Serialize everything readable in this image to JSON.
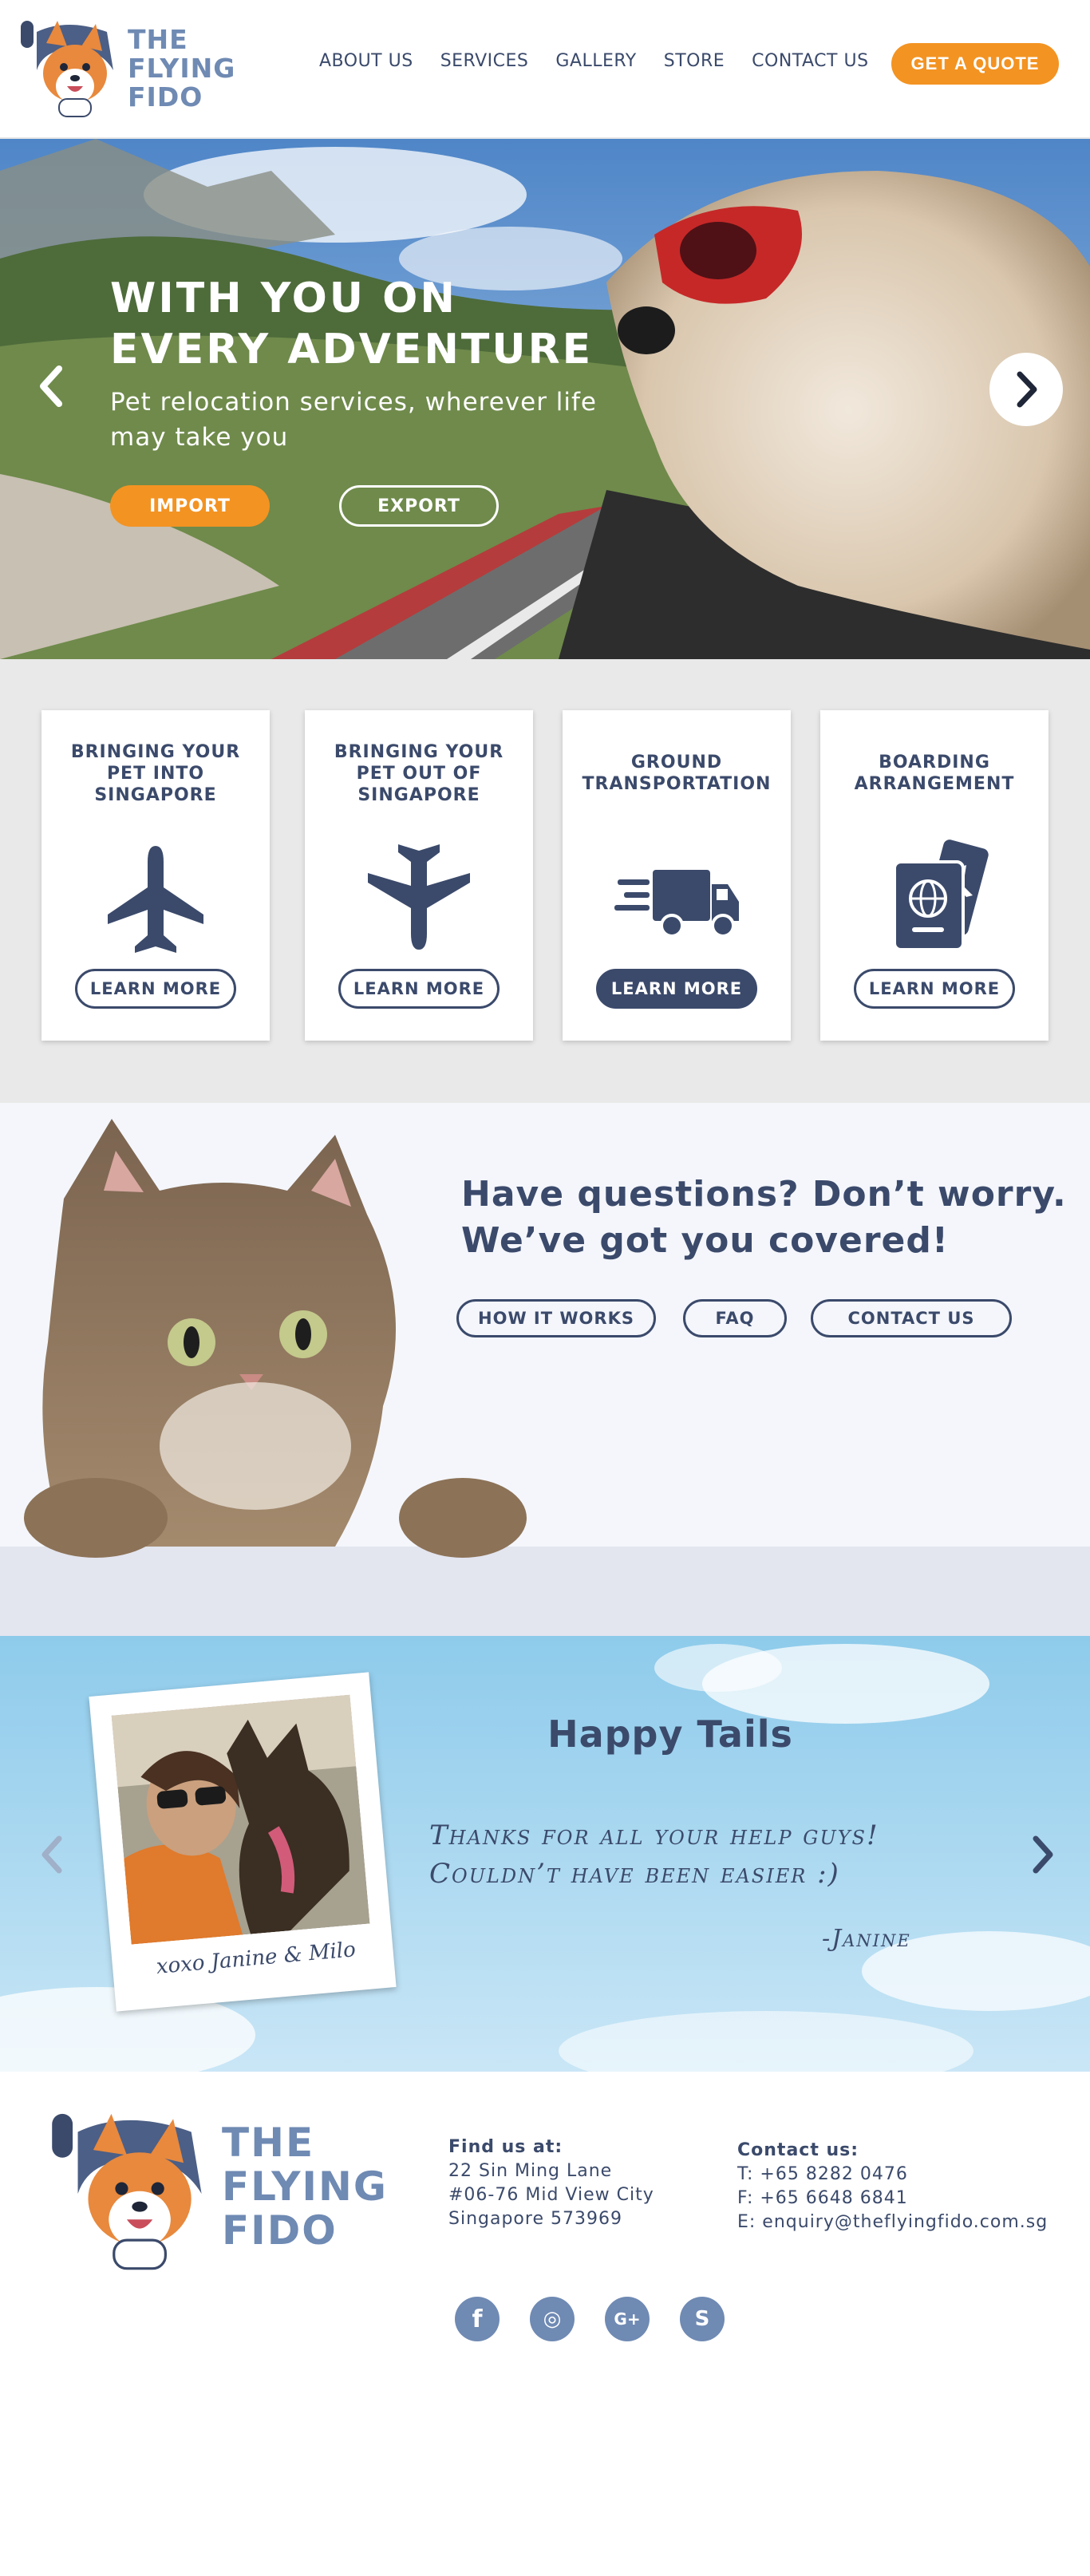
{
  "brand": {
    "logo_line1": "THE",
    "logo_line2": "FLYING",
    "logo_line3": "FIDO"
  },
  "nav": {
    "items": [
      "ABOUT US",
      "SERVICES",
      "GALLERY",
      "STORE",
      "CONTACT US"
    ],
    "cta": "GET A QUOTE"
  },
  "hero": {
    "title_line1": "WITH YOU ON",
    "title_line2": "EVERY ADVENTURE",
    "subtitle": "Pet relocation services, wherever life may take you",
    "import_label": "IMPORT",
    "export_label": "EXPORT"
  },
  "services": {
    "cards": [
      {
        "title": "BRINGING YOUR PET INTO SINGAPORE",
        "icon": "airplane-icon",
        "button": "LEARN MORE"
      },
      {
        "title": "BRINGING YOUR PET OUT OF SINGAPORE",
        "icon": "airplane-icon",
        "button": "LEARN MORE"
      },
      {
        "title": "GROUND TRANSPORTATION",
        "icon": "delivery-truck-icon",
        "button": "LEARN MORE"
      },
      {
        "title": "BOARDING ARRANGEMENT",
        "icon": "passport-icon",
        "button": "LEARN MORE"
      }
    ]
  },
  "questions": {
    "line1": "Have questions? Don’t worry.",
    "line2": "We’ve got you covered!",
    "buttons": [
      "HOW IT WORKS",
      "FAQ",
      "CONTACT US"
    ]
  },
  "testimonial": {
    "title": "Happy Tails",
    "quote_line1": "Thanks for all your help guys!",
    "quote_line2": "Couldn’t have been easier :)",
    "author": "-Janine",
    "photo_caption": "xoxo Janine & Milo"
  },
  "footer": {
    "find_heading": "Find us at:",
    "address": [
      "22 Sin Ming Lane",
      "#06-76 Mid View City",
      "Singapore 573969"
    ],
    "contact_heading": "Contact us:",
    "contact": [
      "T: +65 8282 0476",
      "F: +65 6648 6841",
      "E: enquiry@theflyingfido.com.sg"
    ],
    "social": [
      "facebook-icon",
      "instagram-icon",
      "google-plus-icon",
      "skype-icon"
    ],
    "social_glyphs": [
      "f",
      "◎",
      "G+",
      "S"
    ]
  },
  "colors": {
    "accent": "#f39322",
    "navy": "#3b4a6b",
    "brand_blue": "#6f8ab3",
    "band_gray": "#e9e9e9"
  }
}
